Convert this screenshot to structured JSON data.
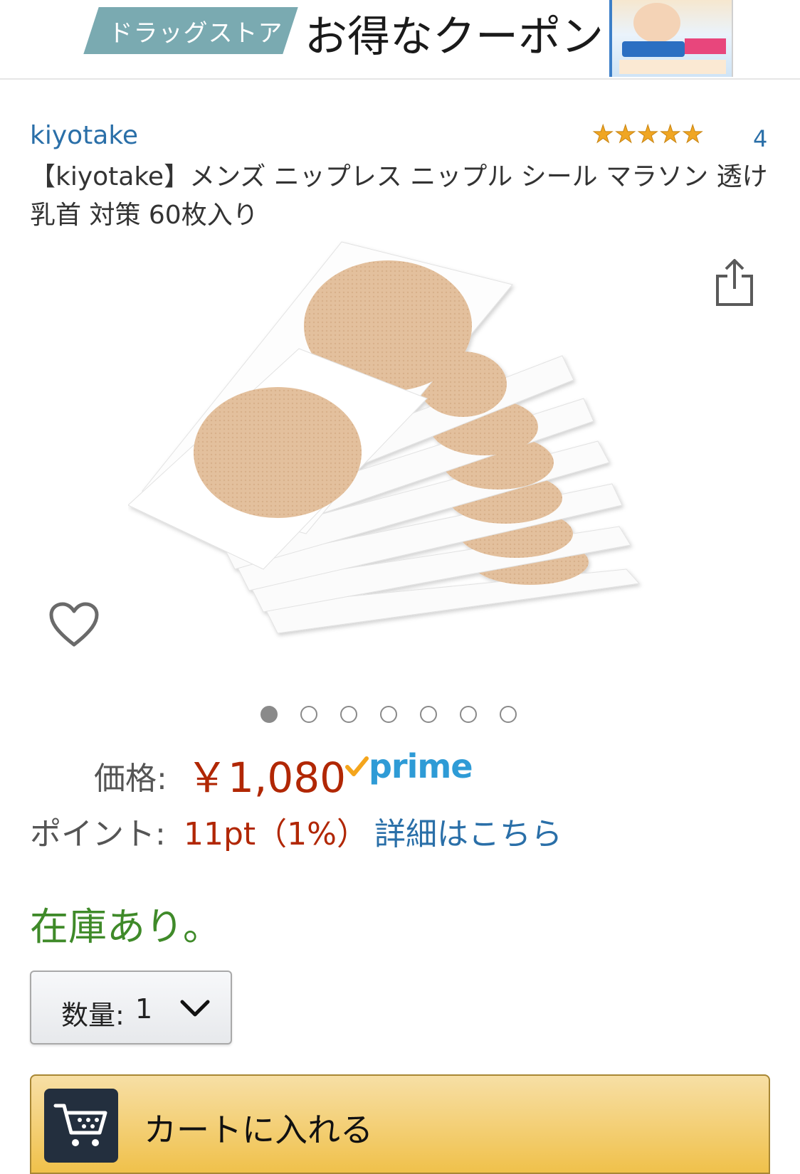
{
  "banner": {
    "tag_text": "ドラッグストア",
    "headline": "お得なクーポン"
  },
  "product": {
    "brand": "kiyotake",
    "rating_stars": 5,
    "rating_count": "4",
    "title": "【kiyotake】メンズ ニップレス ニップル シール マラソン 透け乳首 対策 60枚入り",
    "image_count": 7,
    "active_image_index": 0
  },
  "price": {
    "label": "価格:",
    "value": "￥1,080",
    "prime": "prime"
  },
  "points": {
    "label": "ポイント:",
    "value": "11pt（1%）",
    "link": "詳細はこちら"
  },
  "stock": "在庫あり。",
  "quantity": {
    "label": "数量:",
    "value": "1"
  },
  "cart": {
    "label": "カートに入れる"
  },
  "colors": {
    "price": "#b12704",
    "link": "#2a6fa8",
    "stock": "#3f8a29",
    "prime": "#2e9bd6",
    "cart_button": "#f0c14b"
  }
}
